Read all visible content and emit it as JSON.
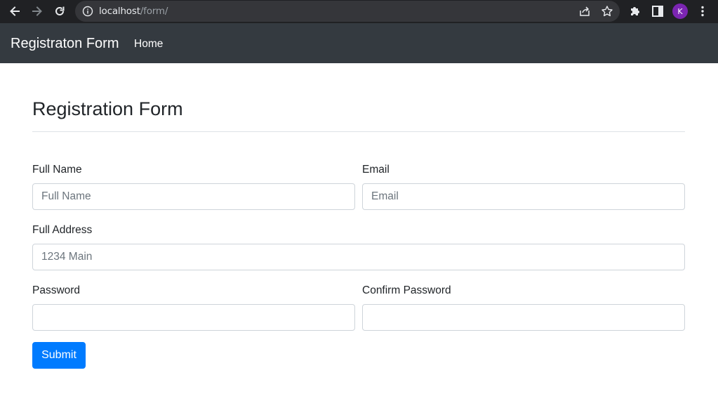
{
  "browser": {
    "url_host": "localhost",
    "url_path": "/form/",
    "profile_initial": "K",
    "icons": [
      "back-arrow-icon",
      "forward-arrow-icon",
      "reload-icon",
      "info-icon",
      "share-icon",
      "bookmark-star-icon",
      "extensions-puzzle-icon",
      "side-panel-icon",
      "kebab-menu-icon"
    ]
  },
  "navbar": {
    "brand": "Registraton Form",
    "home_label": "Home"
  },
  "form": {
    "title": "Registration Form",
    "fullname": {
      "label": "Full Name",
      "placeholder": "Full Name",
      "value": ""
    },
    "email": {
      "label": "Email",
      "placeholder": "Email",
      "value": ""
    },
    "address": {
      "label": "Full Address",
      "placeholder": "1234 Main",
      "value": ""
    },
    "password": {
      "label": "Password",
      "placeholder": "",
      "value": ""
    },
    "confirm_password": {
      "label": "Confirm Password",
      "placeholder": "",
      "value": ""
    },
    "submit_label": "Submit"
  },
  "colors": {
    "navbar_bg": "#343a40",
    "primary": "#007bff",
    "chrome_bg": "#202124",
    "avatar": "#7b25b1"
  }
}
